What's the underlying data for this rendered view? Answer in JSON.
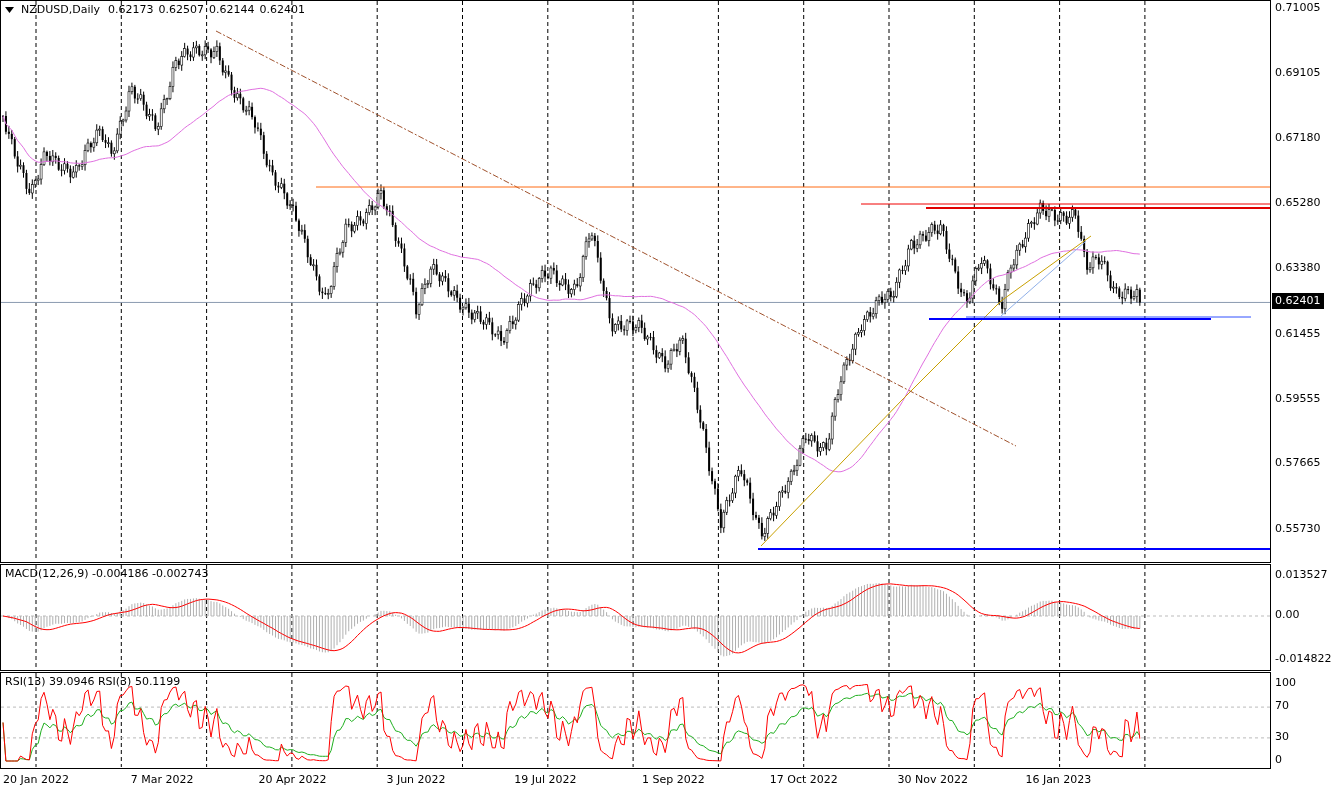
{
  "main_pane": {
    "symbol": "NZDUSD,Daily",
    "ohlc": [
      "0.62173",
      "0.62507",
      "0.62144",
      "0.62401"
    ],
    "price_axis": [
      "0.71005",
      "0.69105",
      "0.67180",
      "0.65280",
      "0.63380",
      "0.61455",
      "0.59555",
      "0.57665",
      "0.55730"
    ],
    "current_price": "0.62401"
  },
  "macd_pane": {
    "label": "MACD(12,26,9) -0.004186 -0.002743",
    "axis": [
      "0.013527",
      "0.00",
      "-0.014822"
    ]
  },
  "rsi_pane": {
    "label": "RSI(13) 39.0946  RSI(3) 50.1199",
    "axis": [
      "100",
      "70",
      "30",
      "0"
    ]
  },
  "date_axis": [
    "20 Jan 2022",
    "7 Mar 2022",
    "20 Apr 2022",
    "3 Jun 2022",
    "19 Jul 2022",
    "1 Sep 2022",
    "17 Oct 2022",
    "30 Nov 2022",
    "16 Jan 2023"
  ]
}
